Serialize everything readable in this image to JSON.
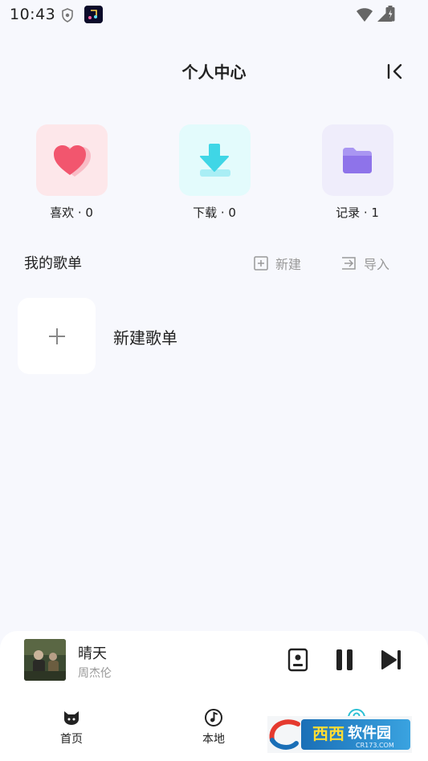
{
  "status_bar": {
    "time": "10:43"
  },
  "header": {
    "title": "个人中心"
  },
  "quick_cards": [
    {
      "label": "喜欢 · 0",
      "icon": "heart-icon",
      "color": "#f2566e"
    },
    {
      "label": "下载 · 0",
      "icon": "download-icon",
      "color": "#3fd6e6"
    },
    {
      "label": "记录 · 1",
      "icon": "folder-icon",
      "color": "#8e73ea"
    }
  ],
  "playlists": {
    "title": "我的歌单",
    "new_label": "新建",
    "import_label": "导入",
    "create_label": "新建歌单"
  },
  "player": {
    "song": "晴天",
    "artist": "周杰伦"
  },
  "nav": [
    {
      "label": "首页",
      "icon": "cat-icon"
    },
    {
      "label": "本地",
      "icon": "music-note-icon"
    },
    {
      "label": "",
      "icon": "user-icon",
      "active": true
    }
  ],
  "colors": {
    "accent": "#2cc0d4",
    "background": "#f7f8fd"
  },
  "watermark": {
    "brand": "西西软件园",
    "url": "CR173.COM"
  }
}
